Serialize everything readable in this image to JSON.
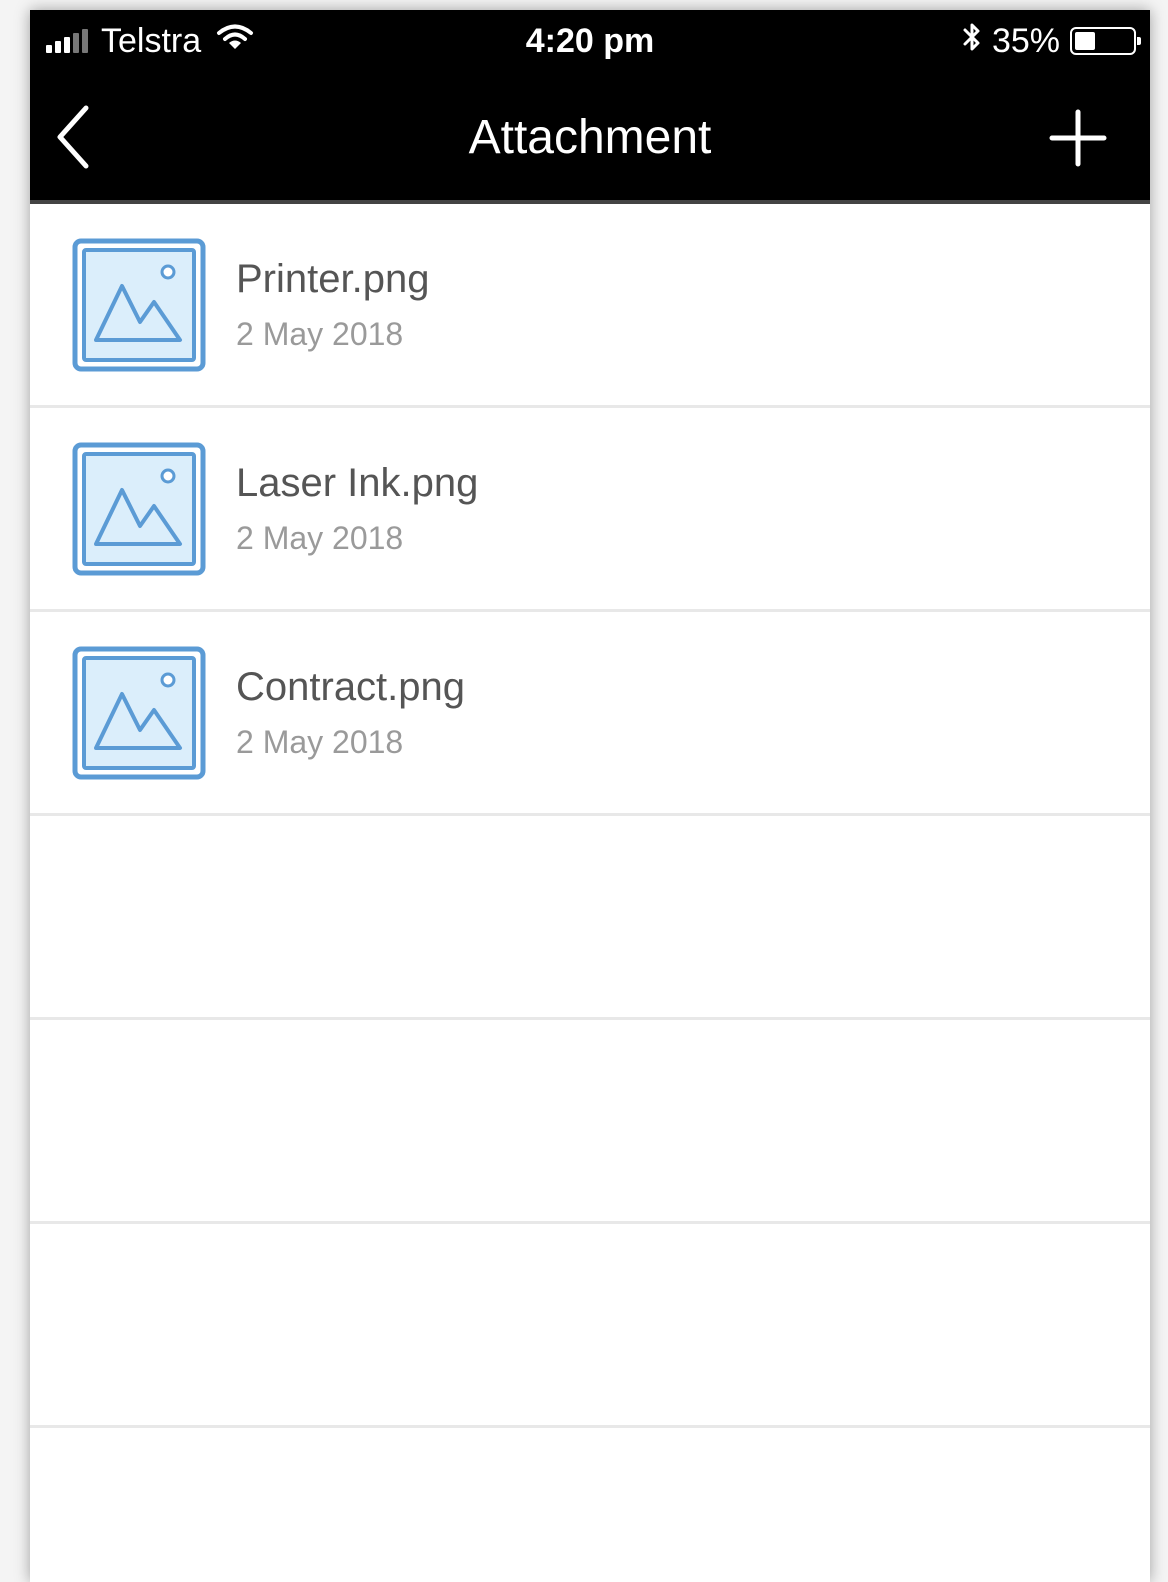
{
  "status_bar": {
    "carrier": "Telstra",
    "time": "4:20 pm",
    "battery_percent_label": "35%",
    "battery_level": 0.35,
    "signal_bars_filled": 3,
    "signal_bars_total": 5
  },
  "nav": {
    "title": "Attachment",
    "back_icon": "chevron-left-icon",
    "add_icon": "plus-icon"
  },
  "attachments": [
    {
      "name": "Printer.png",
      "date": "2 May 2018",
      "icon": "image-file-icon"
    },
    {
      "name": "Laser Ink.png",
      "date": "2 May 2018",
      "icon": "image-file-icon"
    },
    {
      "name": "Contract.png",
      "date": "2 May 2018",
      "icon": "image-file-icon"
    }
  ],
  "empty_rows": 4,
  "colors": {
    "header_bg": "#000000",
    "icon_blue": "#5b9bd5",
    "icon_fill": "#dbeefb",
    "divider": "#e8e8e8",
    "name_text": "#555555",
    "date_text": "#9a9a9a"
  }
}
